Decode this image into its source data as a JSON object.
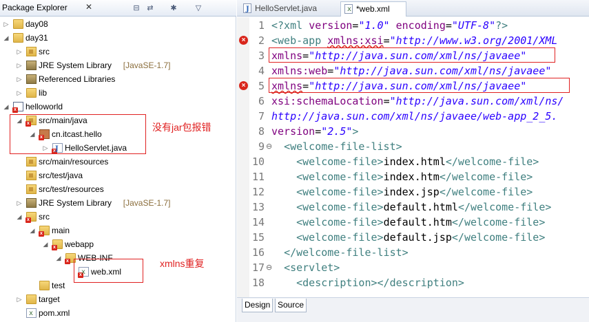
{
  "explorer": {
    "title": "Package Explorer",
    "close_glyph": "✕",
    "toolbar_icons": [
      "collapse-all-icon",
      "link-with-editor-icon",
      "focus-icon",
      "view-menu-icon"
    ],
    "rows": [
      {
        "label": "day08",
        "indent": 0,
        "arrow": "▷",
        "icon": "project-folder"
      },
      {
        "label": "day31",
        "indent": 0,
        "arrow": "◢",
        "icon": "project-folder"
      },
      {
        "label": "src",
        "indent": 1,
        "arrow": "▷",
        "icon": "package-folder"
      },
      {
        "label": "JRE System Library",
        "decoration": "[JavaSE-1.7]",
        "indent": 1,
        "arrow": "▷",
        "icon": "library"
      },
      {
        "label": "Referenced Libraries",
        "indent": 1,
        "arrow": "▷",
        "icon": "library"
      },
      {
        "label": "lib",
        "indent": 1,
        "arrow": "▷",
        "icon": "folder"
      },
      {
        "label": "helloworld",
        "indent": 0,
        "arrow": "◢",
        "icon": "maven-project",
        "error": true
      },
      {
        "label": "src/main/java",
        "indent": 1,
        "arrow": "◢",
        "icon": "package-folder",
        "error": true
      },
      {
        "label": "cn.itcast.hello",
        "indent": 2,
        "arrow": "◢",
        "icon": "package",
        "error": true
      },
      {
        "label": "HelloServlet.java",
        "indent": 3,
        "arrow": "▷",
        "icon": "java-file",
        "error": true
      },
      {
        "label": "src/main/resources",
        "indent": 1,
        "arrow": "",
        "icon": "package-folder"
      },
      {
        "label": "src/test/java",
        "indent": 1,
        "arrow": "",
        "icon": "package-folder"
      },
      {
        "label": "src/test/resources",
        "indent": 1,
        "arrow": "",
        "icon": "package-folder"
      },
      {
        "label": "JRE System Library",
        "decoration": "[JavaSE-1.7]",
        "indent": 1,
        "arrow": "▷",
        "icon": "library"
      },
      {
        "label": "src",
        "indent": 1,
        "arrow": "◢",
        "icon": "folder",
        "error": true
      },
      {
        "label": "main",
        "indent": 2,
        "arrow": "◢",
        "icon": "folder",
        "error": true
      },
      {
        "label": "webapp",
        "indent": 3,
        "arrow": "◢",
        "icon": "folder",
        "error": true
      },
      {
        "label": "WEB-INF",
        "indent": 4,
        "arrow": "◢",
        "icon": "folder",
        "error": true
      },
      {
        "label": "web.xml",
        "indent": 5,
        "arrow": "",
        "icon": "xml-file",
        "error": true
      },
      {
        "label": "test",
        "indent": 2,
        "arrow": "",
        "icon": "folder"
      },
      {
        "label": "target",
        "indent": 1,
        "arrow": "▷",
        "icon": "folder"
      },
      {
        "label": "pom.xml",
        "indent": 1,
        "arrow": "",
        "icon": "maven-file"
      }
    ]
  },
  "annotations": {
    "no_jar_error": "没有jar包报错",
    "xmlns_duplicate": "xmlns重复"
  },
  "editor": {
    "tabs": [
      {
        "label": "HelloServlet.java",
        "active": false
      },
      {
        "label": "*web.xml",
        "active": true,
        "close": "✕"
      }
    ],
    "lines": [
      {
        "n": "1",
        "parts": [
          [
            "tag",
            "<?xml "
          ],
          [
            "attr",
            "version"
          ],
          [
            "txt",
            "="
          ],
          [
            "val",
            "\"1.0\""
          ],
          [
            "txt",
            " "
          ],
          [
            "attr",
            "encoding"
          ],
          [
            "txt",
            "="
          ],
          [
            "val",
            "\"UTF-8\""
          ],
          [
            "tag",
            "?>"
          ]
        ]
      },
      {
        "n": "2",
        "parts": [
          [
            "tag",
            "<web-app "
          ],
          [
            "attr",
            "xmlns:xsi"
          ],
          [
            "txt",
            "="
          ],
          [
            "val",
            "\"http://www.w3.org/2001/XML"
          ]
        ]
      },
      {
        "n": "3",
        "parts": [
          [
            "attr",
            "xmlns"
          ],
          [
            "txt",
            "="
          ],
          [
            "val",
            "\"http://java.sun.com/xml/ns/javaee\""
          ]
        ]
      },
      {
        "n": "4",
        "parts": [
          [
            "attr",
            "xmlns:web"
          ],
          [
            "txt",
            "="
          ],
          [
            "val",
            "\"http://java.sun.com/xml/ns/javaee\""
          ]
        ]
      },
      {
        "n": "5",
        "parts": [
          [
            "attr",
            "xmlns"
          ],
          [
            "txt",
            "="
          ],
          [
            "val",
            "\"http://java.sun.com/xml/ns/javaee\""
          ]
        ]
      },
      {
        "n": "6",
        "parts": [
          [
            "attr",
            "xsi:schemaLocation"
          ],
          [
            "txt",
            "="
          ],
          [
            "val",
            "\"http://java.sun.com/xml/ns/"
          ]
        ]
      },
      {
        "n": "7",
        "parts": [
          [
            "val",
            "http://java.sun.com/xml/ns/javaee/web-app_2_5."
          ]
        ]
      },
      {
        "n": "8",
        "parts": [
          [
            "attr",
            "version"
          ],
          [
            "txt",
            "="
          ],
          [
            "val",
            "\"2.5\""
          ],
          [
            "tag",
            ">"
          ]
        ]
      },
      {
        "n": "9",
        "fold": "⊖",
        "parts": [
          [
            "txt",
            "  "
          ],
          [
            "tag",
            "<welcome-file-list>"
          ]
        ]
      },
      {
        "n": "10",
        "parts": [
          [
            "txt",
            "    "
          ],
          [
            "tag",
            "<welcome-file>"
          ],
          [
            "txt",
            "index.html"
          ],
          [
            "tag",
            "</welcome-file>"
          ]
        ]
      },
      {
        "n": "11",
        "parts": [
          [
            "txt",
            "    "
          ],
          [
            "tag",
            "<welcome-file>"
          ],
          [
            "txt",
            "index.htm"
          ],
          [
            "tag",
            "</welcome-file>"
          ]
        ]
      },
      {
        "n": "12",
        "parts": [
          [
            "txt",
            "    "
          ],
          [
            "tag",
            "<welcome-file>"
          ],
          [
            "txt",
            "index.jsp"
          ],
          [
            "tag",
            "</welcome-file>"
          ]
        ]
      },
      {
        "n": "13",
        "parts": [
          [
            "txt",
            "    "
          ],
          [
            "tag",
            "<welcome-file>"
          ],
          [
            "txt",
            "default.html"
          ],
          [
            "tag",
            "</welcome-file>"
          ]
        ]
      },
      {
        "n": "14",
        "parts": [
          [
            "txt",
            "    "
          ],
          [
            "tag",
            "<welcome-file>"
          ],
          [
            "txt",
            "default.htm"
          ],
          [
            "tag",
            "</welcome-file>"
          ]
        ]
      },
      {
        "n": "15",
        "parts": [
          [
            "txt",
            "    "
          ],
          [
            "tag",
            "<welcome-file>"
          ],
          [
            "txt",
            "default.jsp"
          ],
          [
            "tag",
            "</welcome-file>"
          ]
        ]
      },
      {
        "n": "16",
        "parts": [
          [
            "txt",
            "  "
          ],
          [
            "tag",
            "</welcome-file-list>"
          ]
        ]
      },
      {
        "n": "17",
        "fold": "⊖",
        "parts": [
          [
            "txt",
            "  "
          ],
          [
            "tag",
            "<servlet>"
          ]
        ]
      },
      {
        "n": "18",
        "parts": [
          [
            "txt",
            "    "
          ],
          [
            "tag",
            "<description></description>"
          ]
        ]
      }
    ],
    "error_lines": [
      "2",
      "5"
    ],
    "bottom_tabs": [
      "Design",
      "Source"
    ]
  },
  "colors": {
    "annotation": "#e02020",
    "error": "#d9261c",
    "xml_tag": "#3f7f7f",
    "xml_attr": "#7f007f",
    "xml_value": "#2a00ff"
  }
}
